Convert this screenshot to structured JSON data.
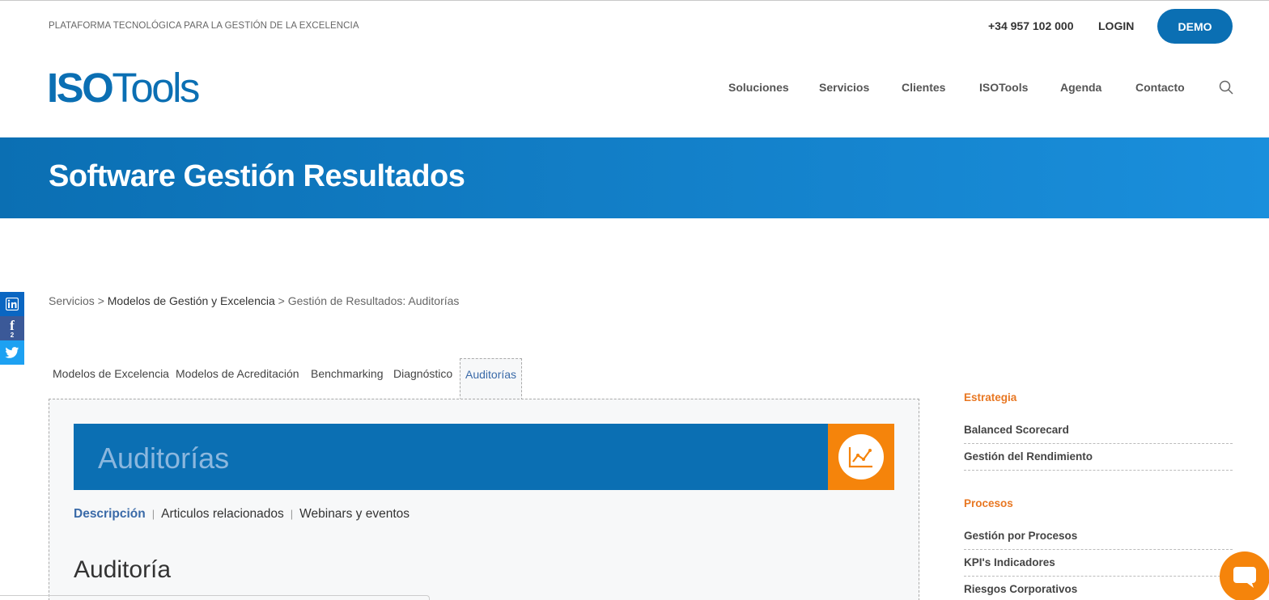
{
  "header": {
    "tagline": "PLATAFORMA TECNOLÓGICA PARA LA GESTIÓN DE LA EXCELENCIA",
    "phone": "+34 957 102 000",
    "login": "LOGIN",
    "demo": "DEMO",
    "logo": {
      "part1": "ISO",
      "part2": "Tools"
    },
    "nav": [
      "Soluciones",
      "Servicios",
      "Clientes",
      "ISOTools",
      "Agenda",
      "Contacto"
    ],
    "search_icon": "search-icon"
  },
  "hero": {
    "title": "Software Gestión Resultados"
  },
  "social": {
    "linkedin": "in",
    "facebook": "f",
    "facebook_count": "2",
    "twitter": "t"
  },
  "breadcrumb": {
    "item1": "Servicios",
    "sep": ">",
    "item2": "Modelos de Gestión y Excelencia",
    "item3": "Gestión de Resultados: Auditorías"
  },
  "tabs": {
    "items": [
      "Modelos de Excelencia",
      "Modelos de Acreditación",
      "Benchmarking",
      "Diagnóstico"
    ],
    "active": "Auditorías"
  },
  "panel": {
    "title": "Auditorías",
    "icon": "chart-line-icon",
    "subnav": {
      "active": "Descripción",
      "item2": "Articulos relacionados",
      "item3": "Webinars y eventos",
      "sep": "|"
    },
    "heading": "Auditoría"
  },
  "sidebar": {
    "cat1": "Estrategia",
    "cat1_items": [
      "Balanced Scorecard",
      "Gestión del Rendimiento"
    ],
    "cat2": "Procesos",
    "cat2_items": [
      "Gestión por Procesos",
      "KPI's Indicadores",
      "Riesgos Corporativos"
    ]
  },
  "colors": {
    "brand_blue": "#0b6fb3",
    "accent_orange": "#f5840b",
    "category_orange": "#e87722"
  }
}
